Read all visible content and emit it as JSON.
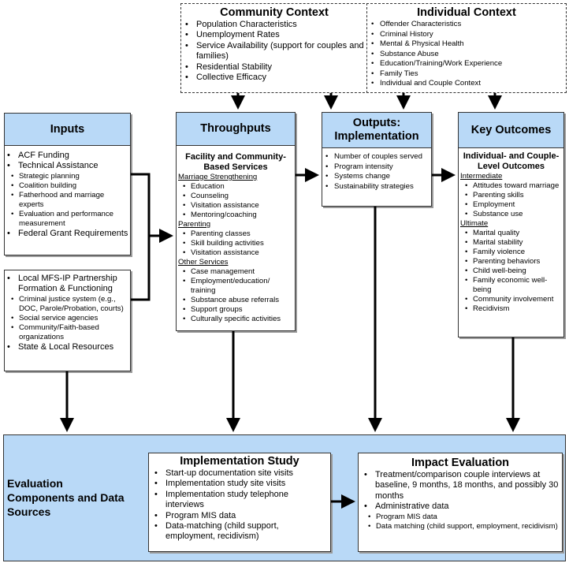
{
  "community": {
    "title": "Community Context",
    "items": [
      "Population Characteristics",
      "Unemployment Rates",
      "Service Availability (support for couples and families)",
      "Residential Stability",
      "Collective Efficacy"
    ]
  },
  "individual": {
    "title": "Individual Context",
    "items": [
      "Offender Characteristics",
      "Criminal History",
      "Mental & Physical Health",
      "Substance Abuse",
      "Education/Training/Work Experience",
      "Family Ties",
      "Individual and Couple Context"
    ]
  },
  "inputs": {
    "title": "Inputs",
    "item1": "ACF Funding",
    "item2": "Technical Assistance",
    "ta_items": [
      "Strategic planning",
      "Coalition building",
      "Fatherhood and marriage experts",
      "Evaluation and performance measurement"
    ],
    "item3": "Federal Grant Requirements",
    "item4": "Local MFS-IP Partnership Formation & Functioning",
    "partner_items": [
      "Criminal justice system (e.g., DOC, Parole/Probation, courts)",
      "Social service agencies",
      "Community/Faith-based organizations"
    ],
    "item5": "State & Local Resources"
  },
  "throughputs": {
    "title": "Throughputs",
    "subtitle": "Facility and Community-Based Services",
    "groups": [
      {
        "label": "Marriage Strengthening",
        "items": [
          "Education",
          "Counseling",
          "Visitation assistance",
          "Mentoring/coaching"
        ]
      },
      {
        "label": "Parenting",
        "items": [
          "Parenting classes",
          "Skill building activities",
          "Visitation assistance"
        ]
      },
      {
        "label": "Other Services",
        "items": [
          "Case management",
          "Employment/education/ training",
          "Substance abuse referrals",
          "Support groups",
          "Culturally specific activities"
        ]
      }
    ]
  },
  "outputs": {
    "title": "Outputs: Implementation",
    "items": [
      "Number of couples served",
      "Program intensity",
      "Systems change",
      "Sustainability strategies"
    ]
  },
  "outcomes": {
    "title": "Key Outcomes",
    "subtitle": "Individual- and Couple-Level Outcomes",
    "intermediate_label": "Intermediate",
    "intermediate": [
      "Attitudes toward marriage",
      "Parenting skills",
      "Employment",
      "Substance use"
    ],
    "ultimate_label": "Ultimate",
    "ultimate": [
      "Marital quality",
      "Marital stability",
      "Family violence",
      "Parenting behaviors",
      "Child well-being",
      "Family economic well-being",
      "Community involvement",
      "Recidivism"
    ]
  },
  "evaluation": {
    "label": "Evaluation Components and Data Sources",
    "implementation": {
      "title": "Implementation Study",
      "items": [
        "Start-up documentation site visits",
        "Implementation study site visits",
        "Implementation study telephone interviews",
        "Program MIS data",
        "Data-matching (child support, employment, recidivism)"
      ]
    },
    "impact": {
      "title": "Impact Evaluation",
      "items": [
        "Treatment/comparison couple interviews at baseline, 9 months, 18 months, and possibly 30 months",
        "Administrative data"
      ],
      "admin_items": [
        "Program MIS data",
        "Data matching (child support, employment, recidivism)"
      ]
    }
  },
  "colors": {
    "header": "#b9d9f7",
    "panel": "#b9d9f7"
  }
}
